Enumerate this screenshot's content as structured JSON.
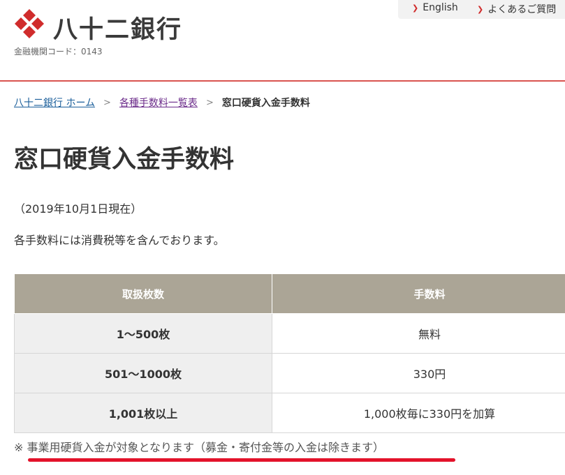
{
  "header": {
    "logo_text": "八十二銀行",
    "bank_code": "金融機関コード：0143",
    "nav": [
      {
        "label": "English"
      },
      {
        "label": "よくあるご質問"
      }
    ]
  },
  "breadcrumb": {
    "items": [
      {
        "label": "八十二銀行 ホーム"
      },
      {
        "label": "各種手数料一覧表"
      }
    ],
    "current": "窓口硬貨入金手数料"
  },
  "main": {
    "title": "窓口硬貨入金手数料",
    "date_note": "（2019年10月1日現在）",
    "tax_note": "各手数料には消費税等を含んでおります。",
    "table": {
      "headers": [
        "取扱枚数",
        "手数料"
      ],
      "rows": [
        {
          "qty": "1～500枚",
          "fee": "無料"
        },
        {
          "qty": "501～1000枚",
          "fee": "330円"
        },
        {
          "qty": "1,001枚以上",
          "fee": "1,000枚毎に330円を加算"
        }
      ]
    },
    "footnote": "※ 事業用硬貨入金が対象となります（募金・寄付金等の入金は除きます）"
  },
  "colors": {
    "brand_red": "#d02c2c",
    "table_header": "#aba596",
    "annotation_red": "#e3122a"
  }
}
